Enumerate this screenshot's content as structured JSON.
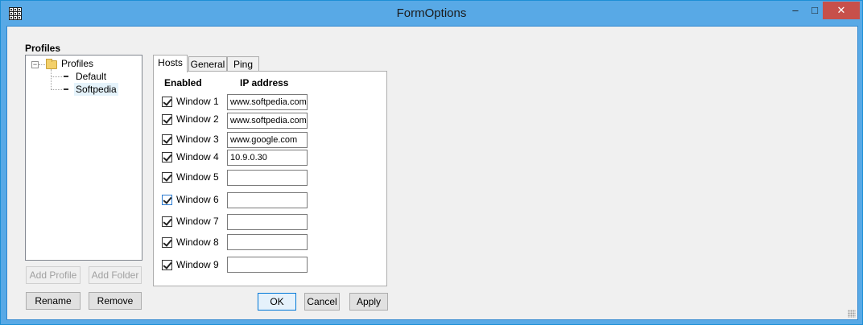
{
  "window": {
    "title": "FormOptions",
    "minimize": "–",
    "maximize": "□",
    "close": "✕"
  },
  "profiles": {
    "label": "Profiles",
    "tree": {
      "root": "Profiles",
      "expander": "−",
      "children": [
        "Default",
        "Softpedia"
      ],
      "selected": "Softpedia"
    },
    "buttons": {
      "add_profile": "Add Profile",
      "add_folder": "Add Folder",
      "rename": "Rename",
      "remove": "Remove"
    }
  },
  "tabs": [
    "Hosts",
    "General",
    "Ping"
  ],
  "active_tab": "Hosts",
  "hosts": {
    "col_enabled": "Enabled",
    "col_ip": "IP address",
    "rows": [
      {
        "label": "Window 1",
        "enabled": true,
        "ip": "www.softpedia.com"
      },
      {
        "label": "Window 2",
        "enabled": true,
        "ip": "www.softpedia.com"
      },
      {
        "label": "Window 3",
        "enabled": true,
        "ip": "www.google.com"
      },
      {
        "label": "Window 4",
        "enabled": true,
        "ip": "10.9.0.30"
      },
      {
        "label": "Window 5",
        "enabled": true,
        "ip": ""
      },
      {
        "label": "Window 6",
        "enabled": true,
        "ip": ""
      },
      {
        "label": "Window 7",
        "enabled": true,
        "ip": ""
      },
      {
        "label": "Window 8",
        "enabled": true,
        "ip": ""
      },
      {
        "label": "Window 9",
        "enabled": true,
        "ip": ""
      }
    ]
  },
  "footer": {
    "ok": "OK",
    "cancel": "Cancel",
    "apply": "Apply"
  },
  "colors": {
    "title_bar": "#58a9e6",
    "close_button": "#c7504a",
    "focus_border": "#0078d7"
  }
}
